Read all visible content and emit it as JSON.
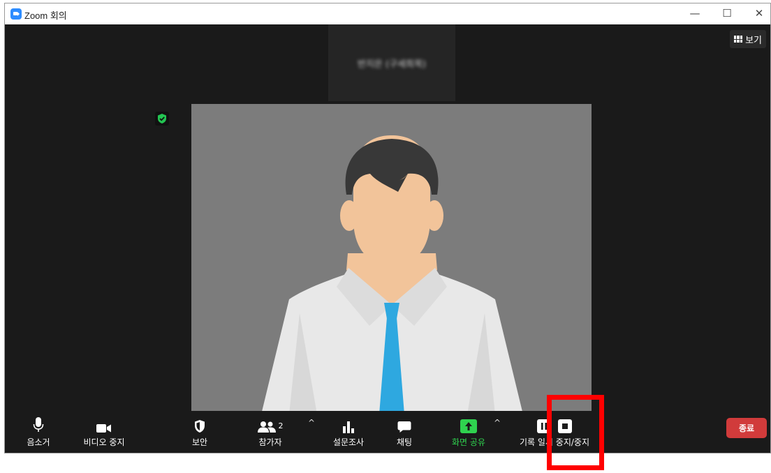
{
  "window": {
    "title": "Zoom 회의",
    "minimize": "—",
    "maximize": "☐",
    "close": "✕"
  },
  "header": {
    "speaker_name": "반지은 (구세희목)",
    "view_label": "보기"
  },
  "toolbar": {
    "mute": "음소거",
    "stop_video": "비디오 중지",
    "security": "보안",
    "participants": "참가자",
    "participants_count": "2",
    "polls": "설문조사",
    "chat": "채팅",
    "share_screen": "화면 공유",
    "recording": "기록 일시 중지/중지",
    "end": "종료"
  },
  "colors": {
    "accent_green": "#2fd34f",
    "end_red": "#d13b3b",
    "highlight_red": "#ff0000",
    "zoom_blue": "#2d8cff"
  }
}
